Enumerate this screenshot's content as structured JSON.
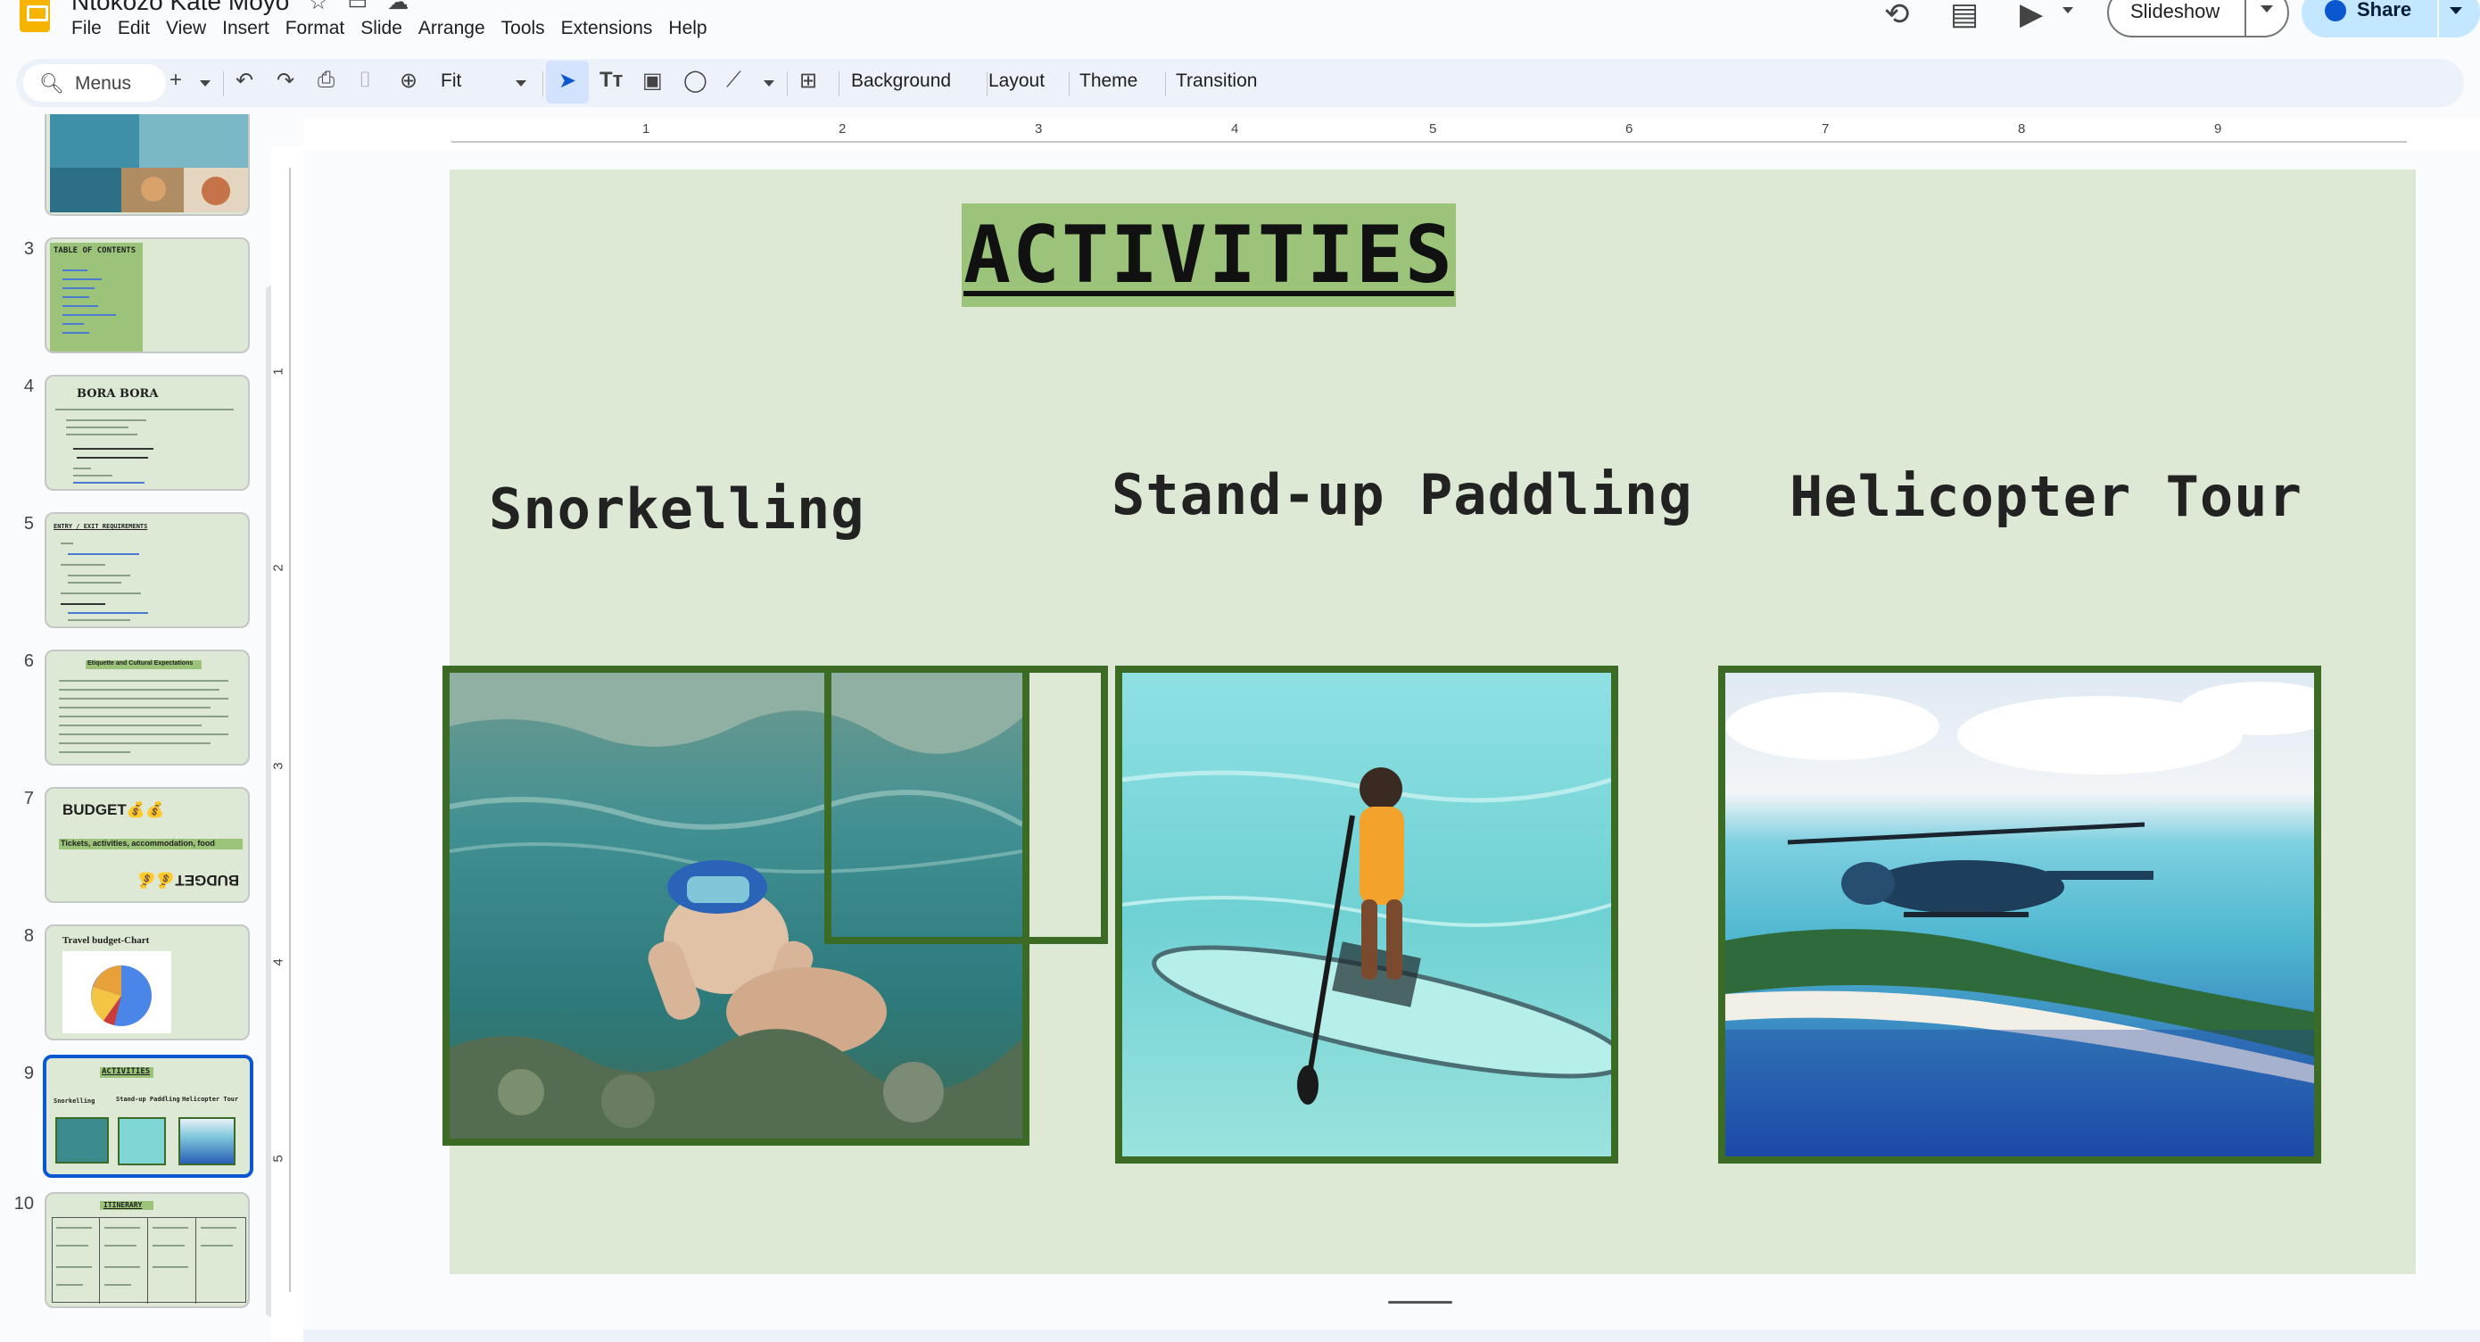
{
  "app": {
    "doc_title": "Ntokozo Kate Moyo",
    "menu": [
      "File",
      "Edit",
      "View",
      "Insert",
      "Format",
      "Slide",
      "Arrange",
      "Tools",
      "Extensions",
      "Help"
    ],
    "slideshow_label": "Slideshow",
    "share_label": "Share"
  },
  "toolbar": {
    "menus_label": "Menus",
    "zoom_value": "Fit",
    "background_label": "Background",
    "layout_label": "Layout",
    "theme_label": "Theme",
    "transition_label": "Transition"
  },
  "filmstrip": {
    "slides": [
      {
        "num": "3",
        "title": "TABLE OF CONTENTS"
      },
      {
        "num": "4",
        "title": "BORA BORA"
      },
      {
        "num": "5",
        "title": "ENTRY / EXIT REQUIREMENTS"
      },
      {
        "num": "6",
        "title": "Etiquette and Cultural Expectations"
      },
      {
        "num": "7",
        "title": "BUDGET💰💰",
        "subtitle": "Tickets, activities, accommodation, food"
      },
      {
        "num": "8",
        "title": "Travel budget-Chart"
      },
      {
        "num": "9",
        "title": "ACTIVITIES",
        "labels": [
          "Snorkelling",
          "Stand-up Paddling",
          "Helicopter Tour"
        ]
      },
      {
        "num": "10",
        "title": "ITINERARY"
      }
    ]
  },
  "ruler": {
    "horizontal": [
      "1",
      "2",
      "3",
      "4",
      "5",
      "6",
      "7",
      "8",
      "9"
    ],
    "vertical": [
      "1",
      "2",
      "3",
      "4",
      "5"
    ]
  },
  "slide": {
    "title": "ACTIVITIES",
    "activities": [
      {
        "label": "Snorkelling"
      },
      {
        "label": "Stand-up Paddling"
      },
      {
        "label": "Helicopter Tour"
      }
    ]
  },
  "colors": {
    "slide_bg": "#dde9d4",
    "title_highlight": "#9cc37a",
    "photo_border": "#3c6b25",
    "selection_blue": "#0b57d0",
    "share_bg": "#c2e7ff"
  }
}
